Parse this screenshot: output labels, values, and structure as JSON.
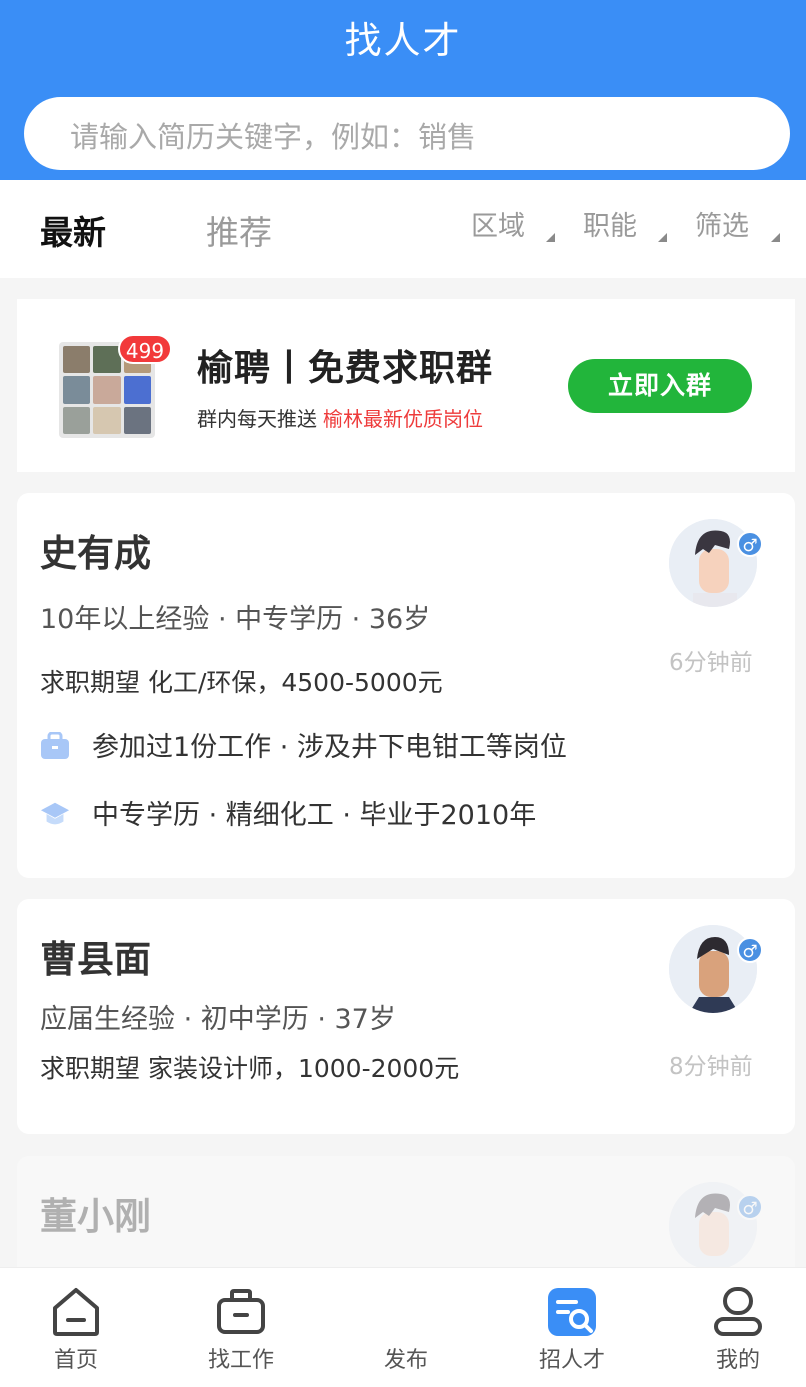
{
  "header": {
    "title": "找人才"
  },
  "search": {
    "placeholder": "请输入简历关键字，例如：销售"
  },
  "tabs": {
    "latest": "最新",
    "recommend": "推荐"
  },
  "filters": {
    "region": "区域",
    "function": "职能",
    "filter": "筛选"
  },
  "banner": {
    "badge": "499",
    "title": "榆聘丨免费求职群",
    "subtitle": "群内每天推送",
    "highlight": "榆林最新优质岗位",
    "button": "立即入群",
    "colors": {
      "button": "#22b53b",
      "highlight": "#ee3b3b"
    }
  },
  "candidates": [
    {
      "name": "史有成",
      "meta": "10年以上经验 · 中专学历 · 36岁",
      "expect": "求职期望 化工/环保，4500-5000元",
      "work": "参加过1份工作 · 涉及井下电钳工等岗位",
      "edu": "中专学历 · 精细化工 · 毕业于2010年",
      "time": "6分钟前",
      "gender": "♂"
    },
    {
      "name": "曹县面",
      "meta": "应届生经验 · 初中学历 · 37岁",
      "expect": "求职期望 家装设计师，1000-2000元",
      "time": "8分钟前",
      "gender": "♂"
    },
    {
      "name": "董小刚",
      "gender": "♂"
    }
  ],
  "nav": {
    "home": "首页",
    "find_job": "找工作",
    "publish": "发布",
    "find_talent": "招人才",
    "mine": "我的"
  },
  "icons": [
    "home-icon",
    "briefcase-icon",
    "talent-search-icon",
    "user-icon",
    "bag-icon",
    "graduation-cap-icon",
    "male-icon"
  ],
  "colors": {
    "primary": "#3a8ef6",
    "active_nav": "#3a8ef6"
  }
}
